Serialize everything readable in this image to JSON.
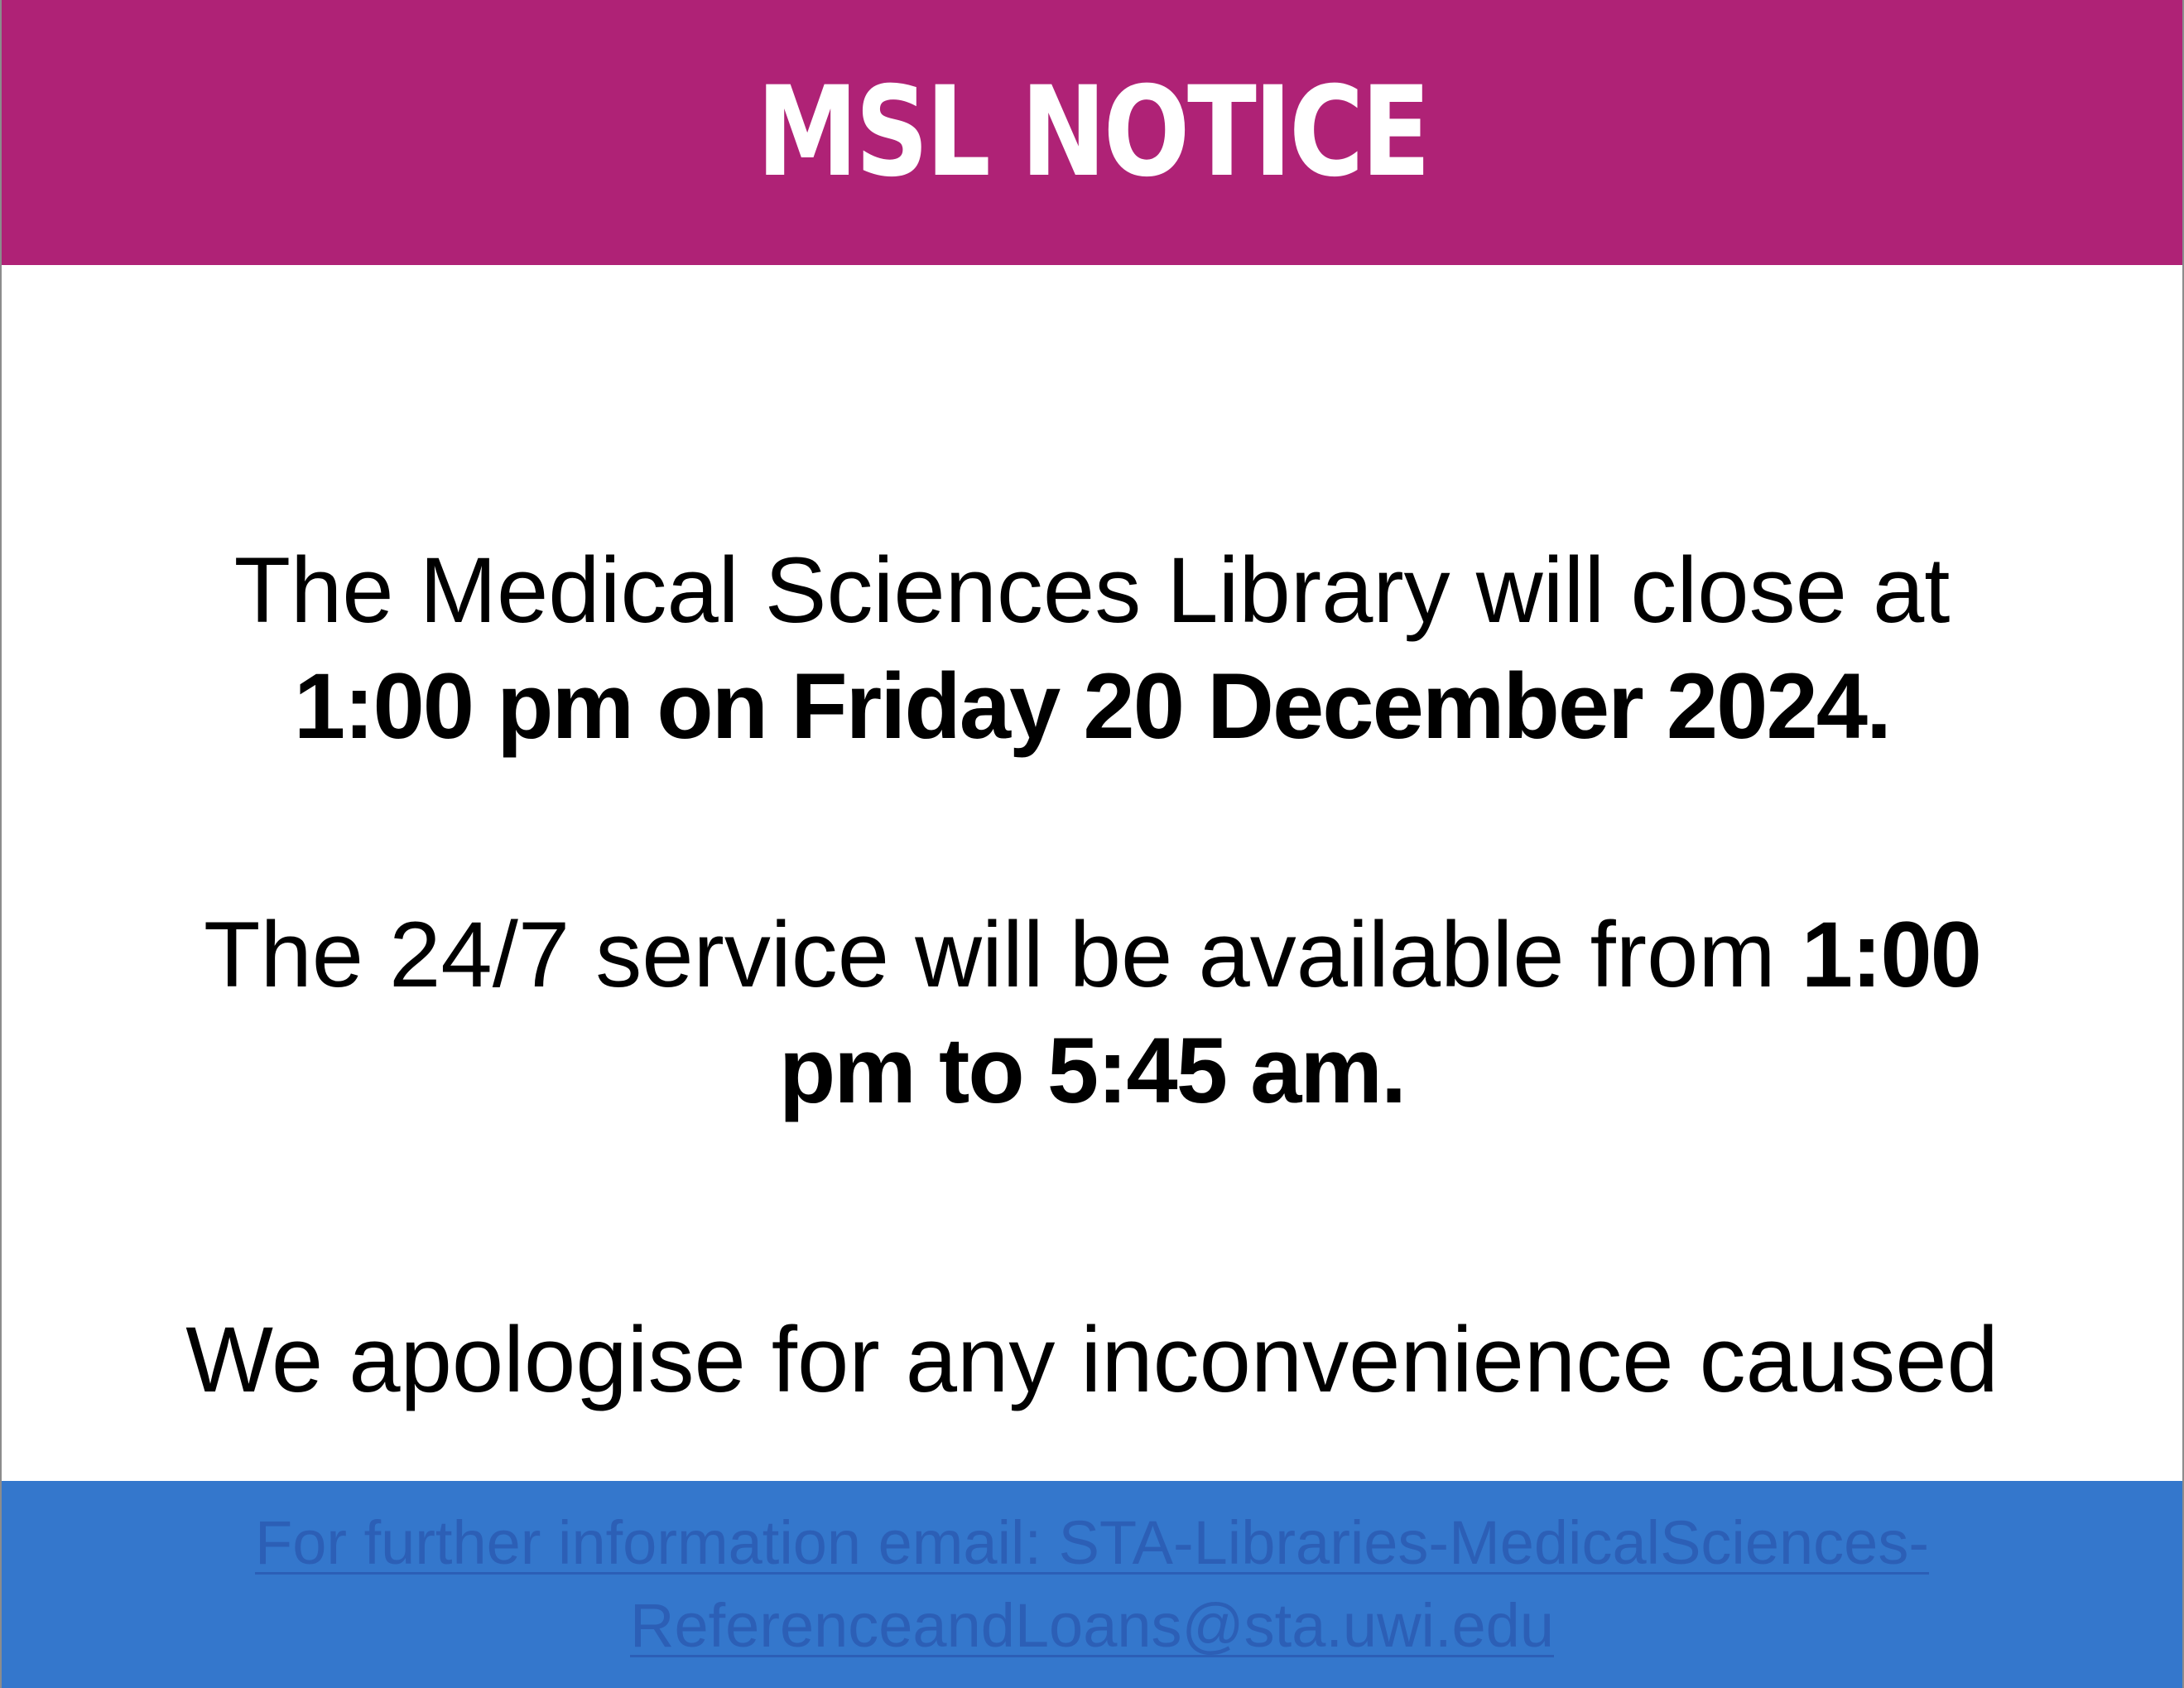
{
  "header": {
    "title": "MSL NOTICE",
    "background_color": "#af2276"
  },
  "notice": {
    "closing_line1": "The Medical Sciences Library will close at",
    "closing_line2": "1:00 pm on Friday 20 December 2024.",
    "service_text": "The 24/7 service will be available from",
    "service_time_start": "1:00",
    "service_time_end": "pm to 5:45 am.",
    "apology": "We apologise for any inconvenience caused"
  },
  "footer": {
    "line1": "For further information email: STA-Libraries-MedicalSciences-",
    "line2": "ReferenceandLoans@sta.uwi.edu",
    "background_color": "#3477cc"
  }
}
